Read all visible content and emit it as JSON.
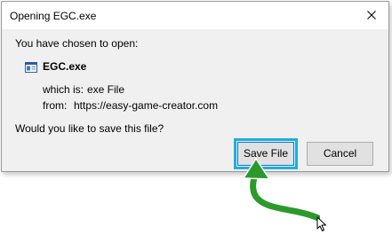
{
  "dialog": {
    "title": "Opening EGC.exe",
    "chosen_text": "You have chosen to open:",
    "file_name": "EGC.exe",
    "which_is_label": "which is:",
    "which_is_value": "exe File",
    "from_label": "from:",
    "from_value": "https://easy-game-creator.com",
    "question": "Would you like to save this file?",
    "save_label": "Save File",
    "cancel_label": "Cancel"
  },
  "icons": {
    "close": "close-icon",
    "file": "application-file-icon",
    "arrow": "curved-arrow-icon",
    "cursor": "mouse-pointer-icon"
  },
  "colors": {
    "highlight": "#1eaedb",
    "arrow_green": "#2b9a2b",
    "dialog_bg": "#f0f0f0"
  }
}
